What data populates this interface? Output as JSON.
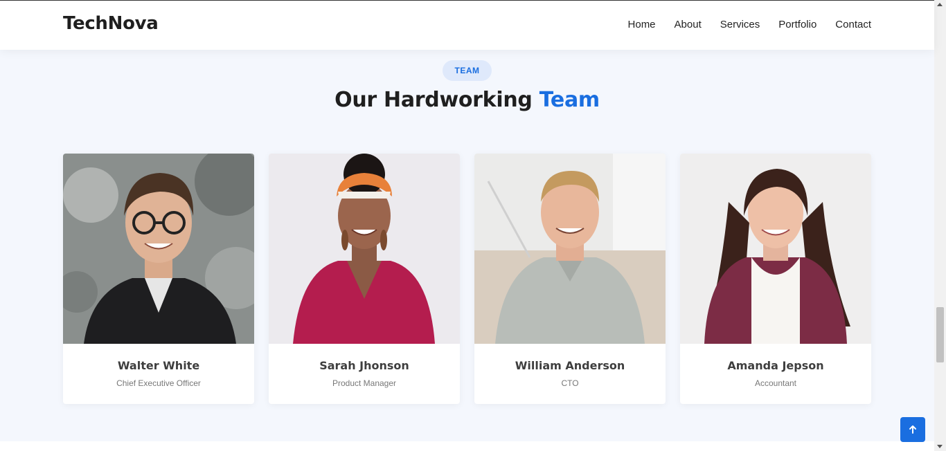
{
  "brand": "TechNova",
  "nav": [
    "Home",
    "About",
    "Services",
    "Portfolio",
    "Contact"
  ],
  "section": {
    "badge": "TEAM",
    "title_main": "Our Hardworking",
    "title_accent": "Team"
  },
  "team": [
    {
      "name": "Walter White",
      "role": "Chief Executive Officer",
      "photo": "portrait-man-glasses-hoodie"
    },
    {
      "name": "Sarah Jhonson",
      "role": "Product Manager",
      "photo": "portrait-woman-headwrap"
    },
    {
      "name": "William Anderson",
      "role": "CTO",
      "photo": "portrait-man-polo"
    },
    {
      "name": "Amanda Jepson",
      "role": "Accountant",
      "photo": "portrait-woman-cardigan"
    }
  ],
  "colors": {
    "accent": "#1a6ee0",
    "badge_bg": "#dfe9fb",
    "page_bg": "#f4f7fd"
  },
  "icons": {
    "back_to_top": "arrow-up-icon"
  }
}
